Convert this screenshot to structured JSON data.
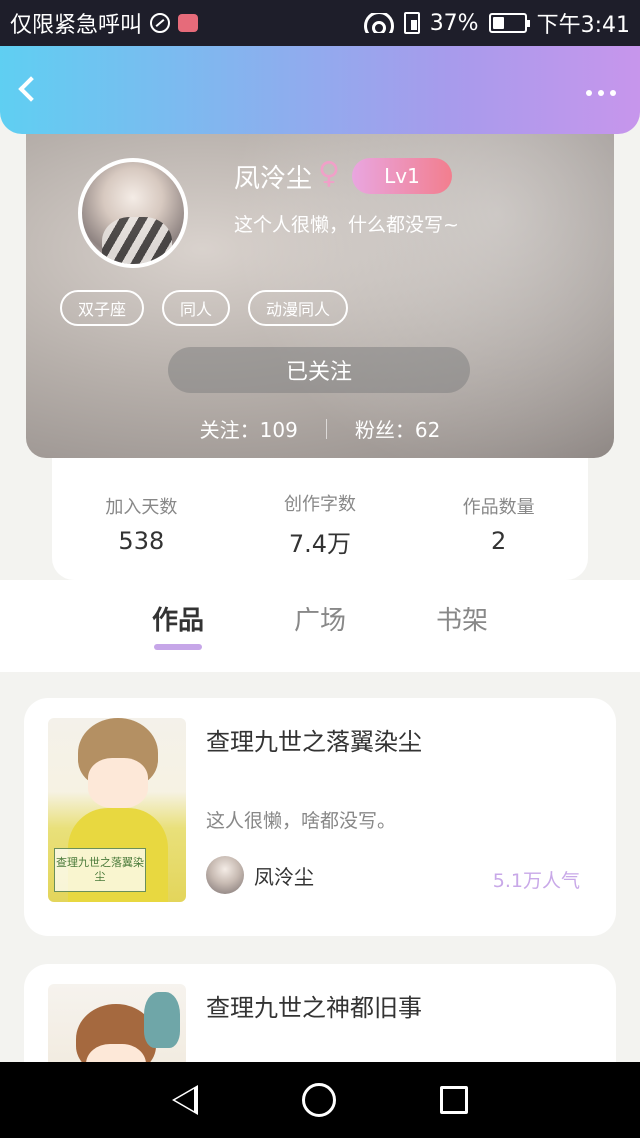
{
  "status_bar": {
    "carrier": "仅限紧急呼叫",
    "battery": "37%",
    "battery_level": 0.37,
    "time": "下午3:41"
  },
  "profile": {
    "username": "凤泠尘",
    "gender": "♀",
    "level": "Lv1",
    "bio": "这个人很懒，什么都没写~",
    "tags": [
      "双子座",
      "同人",
      "动漫同人"
    ],
    "follow_button": "已关注",
    "following": "关注：109",
    "followers": "粉丝：62"
  },
  "info": {
    "join_days_label": "加入天数",
    "join_days": "538",
    "words_label": "创作字数",
    "words": "7.4万",
    "works_label": "作品数量",
    "works": "2"
  },
  "tabs": [
    "作品",
    "广场",
    "书架"
  ],
  "active_tab": "作品",
  "works": [
    {
      "title": "查理九世之落翼染尘",
      "description": "这人很懒，啥都没写。",
      "author": "凤泠尘",
      "popularity": "5.1万人气",
      "cover_text": "查理九世之落翼染尘"
    },
    {
      "title": "查理九世之神都旧事"
    }
  ],
  "colors": {
    "header_start": "#5fcff2",
    "header_end": "#c796ec",
    "tab_indicator": "#c6a6e8",
    "popularity": "#c8a8e8",
    "level_badge": "#f27e8e"
  }
}
